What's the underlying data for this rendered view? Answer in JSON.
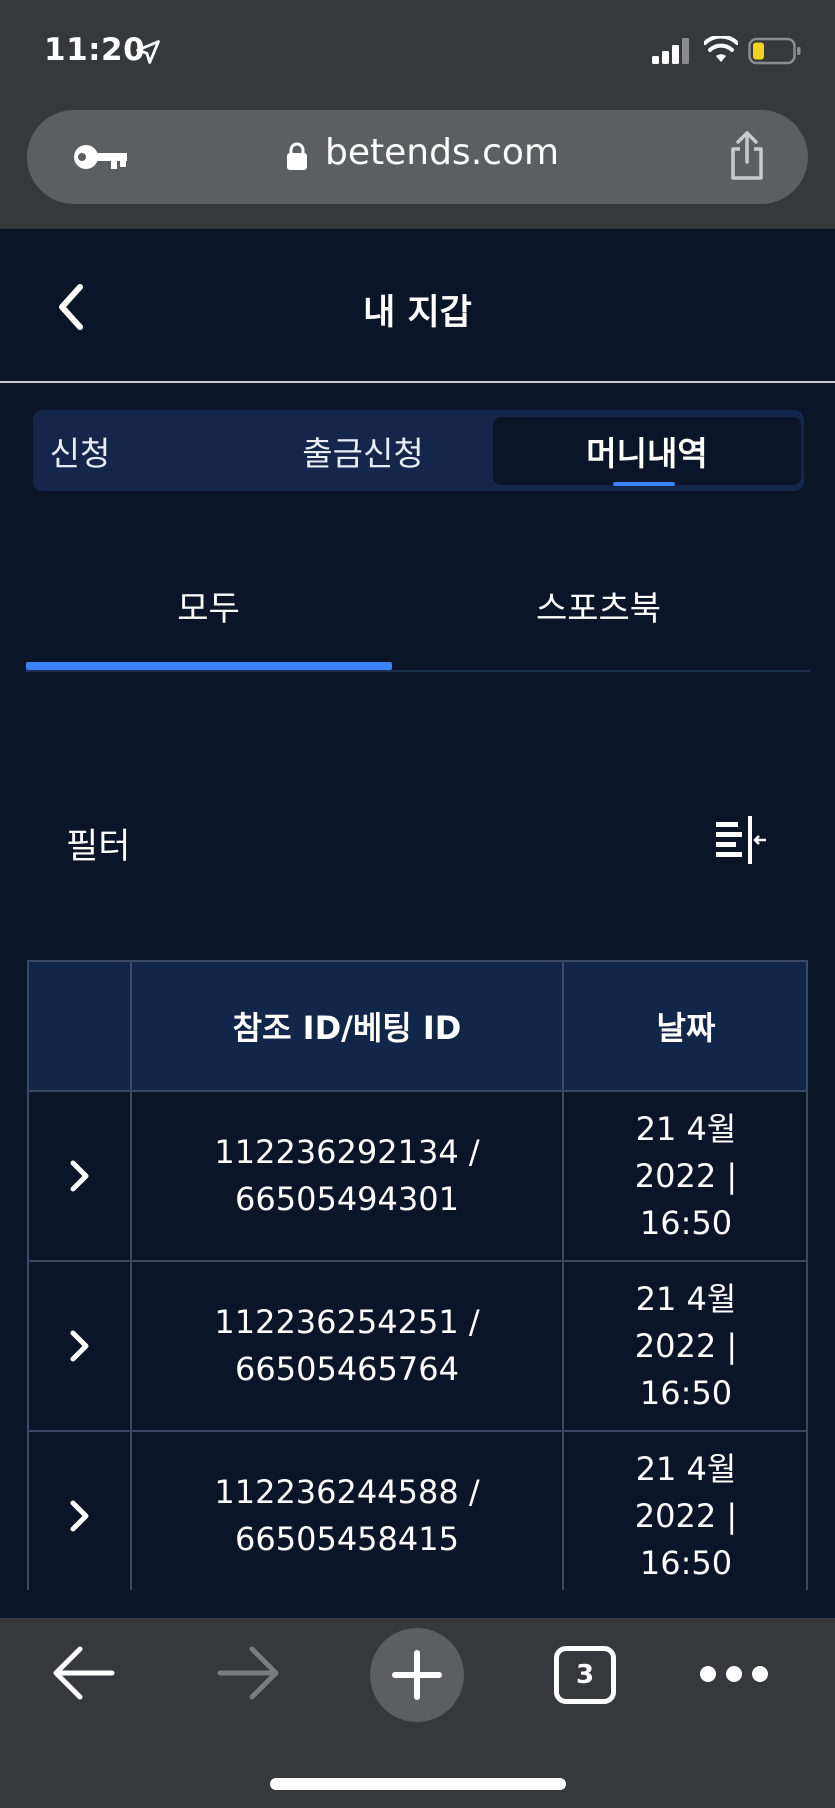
{
  "status_bar": {
    "time": "11:20"
  },
  "browser": {
    "url": "betends.com",
    "tab_count": "3"
  },
  "header": {
    "title": "내 지갑"
  },
  "top_tabs": [
    {
      "label": "신청"
    },
    {
      "label": "출금신청"
    },
    {
      "label": "머니내역",
      "active": true
    }
  ],
  "sub_tabs": [
    {
      "label": "모두",
      "active": true
    },
    {
      "label": "스포츠북"
    }
  ],
  "filter": {
    "label": "필터"
  },
  "table": {
    "headers": [
      "",
      "참조 ID/베팅 ID",
      "날짜"
    ],
    "rows": [
      {
        "ref_id": "112236292134 /",
        "bet_id": "66505494301",
        "date_line1": "21 4월",
        "date_line2": "2022 |",
        "date_line3": "16:50"
      },
      {
        "ref_id": "112236254251 /",
        "bet_id": "66505465764",
        "date_line1": "21 4월",
        "date_line2": "2022 |",
        "date_line3": "16:50"
      },
      {
        "ref_id": "112236244588 /",
        "bet_id": "66505458415",
        "date_line1": "21 4월",
        "date_line2": "2022 |",
        "date_line3": "16:50"
      }
    ]
  },
  "colors": {
    "accent": "#3b82f6",
    "background": "#0a1628",
    "tab_bg": "#15264a",
    "chrome": "#37383c"
  }
}
